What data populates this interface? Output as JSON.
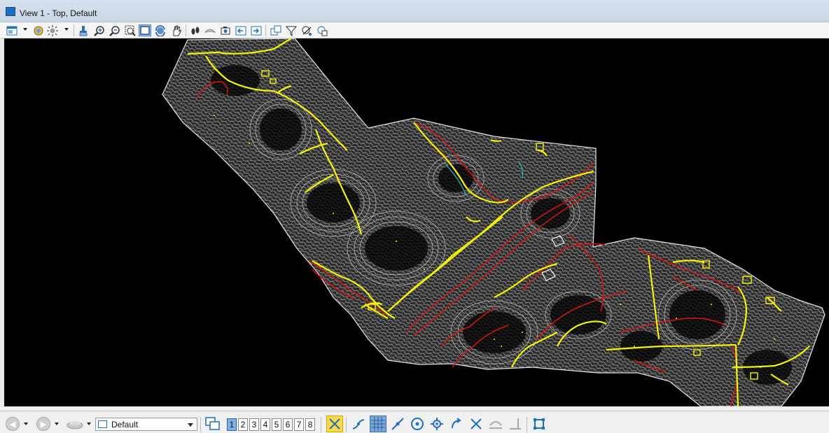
{
  "window": {
    "title": "View 1 - Top, Default"
  },
  "view_toolbar": {
    "icons": [
      "view-attributes-icon",
      "display-style-icon",
      "lighting-icon",
      "update-view-icon",
      "zoom-in-icon",
      "zoom-out-icon",
      "window-area-icon",
      "fit-view-icon",
      "rotate-view-icon",
      "pan-view-icon",
      "walk-icon",
      "fly-icon",
      "camera-icon",
      "previous-view-icon",
      "next-view-icon",
      "copy-view-icon",
      "clip-volume-icon",
      "clip-mask-icon",
      "view-settings-icon"
    ]
  },
  "canvas": {
    "background": "#000000",
    "colors": {
      "contours": "#a8a8a8",
      "roads": "#f5f500",
      "red_features": "#d21414",
      "boundary": "#e6e6e6",
      "water": "#1fb3b3"
    }
  },
  "status_bar": {
    "view_group": "Default",
    "view_numbers": [
      "1",
      "2",
      "3",
      "4",
      "5",
      "6",
      "7",
      "8"
    ],
    "active_view": "1",
    "snap_modes": [
      "intersection-snap-icon",
      "nearest-snap-icon",
      "keypoint-snap-icon",
      "midpoint-snap-icon",
      "center-snap-icon",
      "origin-snap-icon",
      "bisector-snap-icon",
      "tangent-snap-icon",
      "perpendicular-snap-icon",
      "parallel-snap-icon",
      "point-on-snap-icon"
    ]
  }
}
